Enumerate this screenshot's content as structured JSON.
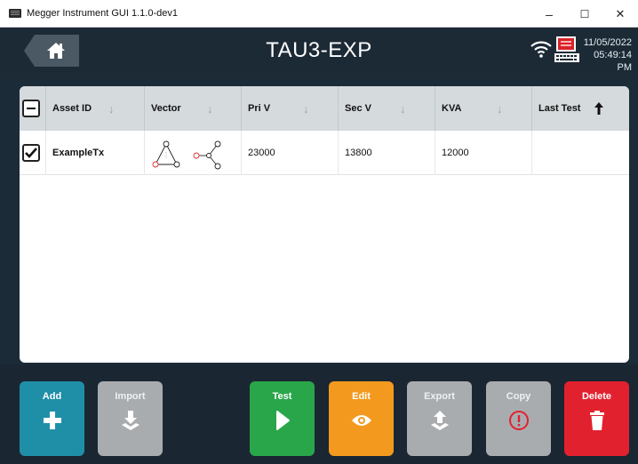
{
  "window": {
    "title": "Megger Instrument GUI 1.1.0-dev1",
    "minimize": "–",
    "maximize": "☐",
    "close": "✕"
  },
  "header": {
    "title": "TAU3-EXP",
    "date": "11/05/2022",
    "time": "05:49:14 PM",
    "icons": [
      "home-icon",
      "wifi-icon",
      "megger-device-icon"
    ]
  },
  "table": {
    "columns": [
      {
        "label": "Asset ID",
        "sort": "down"
      },
      {
        "label": "Vector",
        "sort": "down"
      },
      {
        "label": "Pri V",
        "sort": "down"
      },
      {
        "label": "Sec V",
        "sort": "down"
      },
      {
        "label": "KVA",
        "sort": "down"
      },
      {
        "label": "Last Test",
        "sort": "up-active"
      }
    ],
    "rows": [
      {
        "checked": true,
        "asset_id": "ExampleTx",
        "vector": "delta-wye-diagram",
        "pri_v": "23000",
        "sec_v": "13800",
        "kva": "12000",
        "last_test": ""
      }
    ],
    "sort_glyph": "↓",
    "sort_active_glyph": "🡑"
  },
  "actions": [
    {
      "label": "Add",
      "icon": "plus-icon",
      "color": "#1f8fa8",
      "enabled": true
    },
    {
      "label": "Import",
      "icon": "import-icon",
      "color": "#a9acaf",
      "enabled": false
    },
    {
      "label": "Test",
      "icon": "play-icon",
      "color": "#2aa64a",
      "enabled": true
    },
    {
      "label": "Edit",
      "icon": "eye-icon",
      "color": "#f39a1e",
      "enabled": true
    },
    {
      "label": "Export",
      "icon": "export-icon",
      "color": "#a9acaf",
      "enabled": false
    },
    {
      "label": "Copy",
      "icon": "alert-icon",
      "color": "#a9acaf",
      "enabled": false
    },
    {
      "label": "Delete",
      "icon": "trash-icon",
      "color": "#e2212f",
      "enabled": true
    }
  ],
  "colors": {
    "background": "#1b2b38",
    "header_bg": "#d5dadd",
    "alert_red": "#e2212f"
  }
}
